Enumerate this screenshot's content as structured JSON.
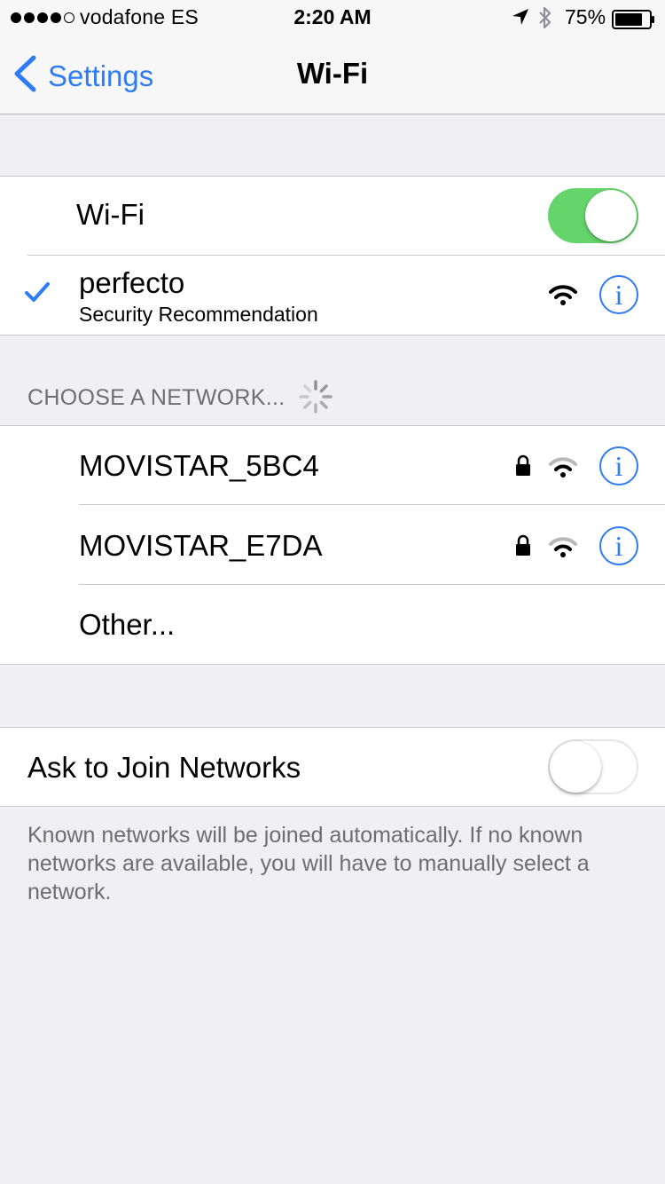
{
  "status_bar": {
    "carrier": "vodafone ES",
    "time": "2:20 AM",
    "battery": "75%",
    "signal_bars": 4,
    "signal_total": 5
  },
  "nav": {
    "back_label": "Settings",
    "title": "Wi-Fi"
  },
  "wifi": {
    "label": "Wi-Fi",
    "enabled": true
  },
  "connected": {
    "name": "perfecto",
    "subtitle": "Security Recommendation",
    "info": "i"
  },
  "choose_section": {
    "header": "CHOOSE A NETWORK..."
  },
  "networks": [
    {
      "name": "MOVISTAR_5BC4",
      "secured": true,
      "info": "i"
    },
    {
      "name": "MOVISTAR_E7DA",
      "secured": true,
      "info": "i"
    }
  ],
  "other": {
    "label": "Other..."
  },
  "ask_join": {
    "label": "Ask to Join Networks",
    "enabled": false
  },
  "footer": {
    "text": "Known networks will be joined automatically. If no known networks are available, you will have to manually select a network."
  },
  "colors": {
    "accent": "#2e7cf6",
    "toggle_on": "#65d56b",
    "background": "#efeff4"
  }
}
